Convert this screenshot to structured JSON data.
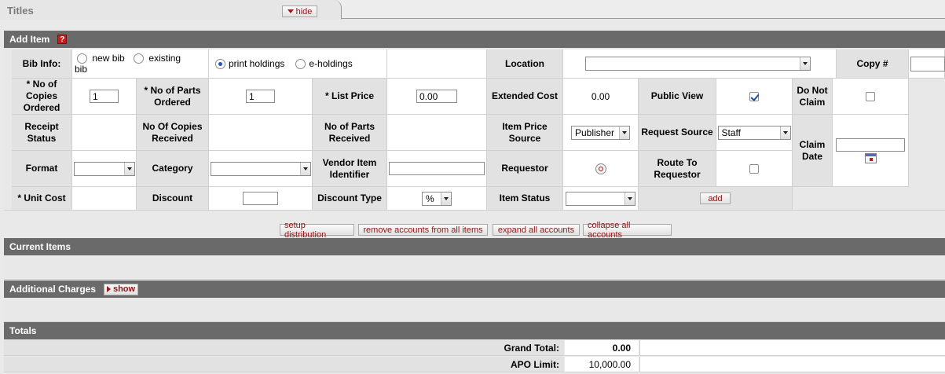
{
  "tab": {
    "title": "Titles",
    "hide_label": "hide"
  },
  "add_item": {
    "header": "Add Item",
    "help_icon": "?",
    "bib_info_label": "Bib Info:",
    "new_bib": "new bib",
    "existing_bib_1": "existing",
    "existing_bib_2": "bib",
    "print_holdings": "print holdings",
    "e_holdings": "e-holdings",
    "location_label": "Location",
    "copy_label": "Copy #",
    "no_copies_ordered": "* No of Copies Ordered",
    "no_copies_ordered_value": "1",
    "no_parts_ordered": "* No of Parts Ordered",
    "no_parts_ordered_value": "1",
    "list_price": "* List Price",
    "list_price_value": "0.00",
    "extended_cost": "Extended Cost",
    "extended_cost_value": "0.00",
    "public_view": "Public View",
    "do_not_claim": "Do Not Claim",
    "receipt_status": "Receipt Status",
    "no_copies_received": "No Of Copies Received",
    "no_parts_received": "No of Parts Received",
    "item_price_source": "Item Price Source",
    "item_price_source_value": "Publisher",
    "request_source": "Request Source",
    "request_source_value": "Staff",
    "claim_date": "Claim Date",
    "format": "Format",
    "category": "Category",
    "vendor_item_identifier": "Vendor Item Identifier",
    "requestor": "Requestor",
    "route_to_requestor": "Route To Requestor",
    "unit_cost": "* Unit Cost",
    "discount": "Discount",
    "discount_type": "Discount Type",
    "discount_type_value": "%",
    "item_status": "Item Status",
    "add_label": "add"
  },
  "buttons": {
    "setup_distribution": "setup distribution",
    "remove_accounts": "remove accounts from all items",
    "expand_accounts": "expand all accounts",
    "collapse_accounts": "collapse all accounts"
  },
  "current_items": {
    "header": "Current Items"
  },
  "additional_charges": {
    "header": "Additional Charges",
    "show_label": "show"
  },
  "totals": {
    "header": "Totals",
    "grand_total_label": "Grand Total:",
    "grand_total_value": "0.00",
    "apo_limit_label": "APO Limit:",
    "apo_limit_value": "10,000.00"
  },
  "icons": {
    "hide": "triangle-down-icon",
    "show": "triangle-right-icon",
    "help": "help-icon",
    "requestor_lookup": "magnifier-icon",
    "claim_date_calendar": "calendar-icon"
  },
  "colors": {
    "section_header": "#6a6a6a",
    "button_text": "#8a1515",
    "help_icon": "#c81c1c"
  }
}
